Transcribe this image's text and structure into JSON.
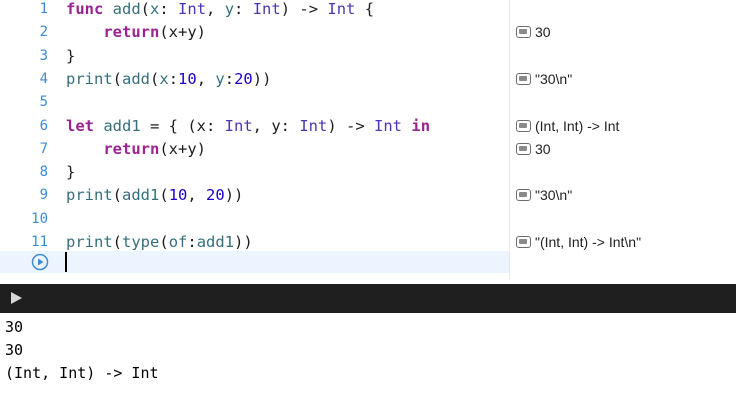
{
  "editor": {
    "lines": [
      {
        "num": "1",
        "tokens": [
          {
            "t": "keyword",
            "v": "func"
          },
          {
            "t": "plain",
            "v": " "
          },
          {
            "t": "func",
            "v": "add"
          },
          {
            "t": "plain",
            "v": "("
          },
          {
            "t": "func",
            "v": "x"
          },
          {
            "t": "plain",
            "v": ": "
          },
          {
            "t": "type",
            "v": "Int"
          },
          {
            "t": "plain",
            "v": ", "
          },
          {
            "t": "func",
            "v": "y"
          },
          {
            "t": "plain",
            "v": ": "
          },
          {
            "t": "type",
            "v": "Int"
          },
          {
            "t": "plain",
            "v": ") -> "
          },
          {
            "t": "type",
            "v": "Int"
          },
          {
            "t": "plain",
            "v": " {"
          }
        ]
      },
      {
        "num": "2",
        "tokens": [
          {
            "t": "plain",
            "v": "    "
          },
          {
            "t": "keyword",
            "v": "return"
          },
          {
            "t": "plain",
            "v": "(x+y)"
          }
        ]
      },
      {
        "num": "3",
        "tokens": [
          {
            "t": "plain",
            "v": "}"
          }
        ]
      },
      {
        "num": "4",
        "tokens": [
          {
            "t": "func",
            "v": "print"
          },
          {
            "t": "plain",
            "v": "("
          },
          {
            "t": "func",
            "v": "add"
          },
          {
            "t": "plain",
            "v": "("
          },
          {
            "t": "func",
            "v": "x"
          },
          {
            "t": "plain",
            "v": ":"
          },
          {
            "t": "num",
            "v": "10"
          },
          {
            "t": "plain",
            "v": ", "
          },
          {
            "t": "func",
            "v": "y"
          },
          {
            "t": "plain",
            "v": ":"
          },
          {
            "t": "num",
            "v": "20"
          },
          {
            "t": "plain",
            "v": "))"
          }
        ]
      },
      {
        "num": "5",
        "tokens": []
      },
      {
        "num": "6",
        "tokens": [
          {
            "t": "keyword",
            "v": "let"
          },
          {
            "t": "plain",
            "v": " "
          },
          {
            "t": "func",
            "v": "add1"
          },
          {
            "t": "plain",
            "v": " = { (x: "
          },
          {
            "t": "type",
            "v": "Int"
          },
          {
            "t": "plain",
            "v": ", y: "
          },
          {
            "t": "type",
            "v": "Int"
          },
          {
            "t": "plain",
            "v": ") -> "
          },
          {
            "t": "type",
            "v": "Int"
          },
          {
            "t": "plain",
            "v": " "
          },
          {
            "t": "keyword",
            "v": "in"
          }
        ]
      },
      {
        "num": "7",
        "tokens": [
          {
            "t": "plain",
            "v": "    "
          },
          {
            "t": "keyword",
            "v": "return"
          },
          {
            "t": "plain",
            "v": "(x+y)"
          }
        ]
      },
      {
        "num": "8",
        "tokens": [
          {
            "t": "plain",
            "v": "}"
          }
        ]
      },
      {
        "num": "9",
        "tokens": [
          {
            "t": "func",
            "v": "print"
          },
          {
            "t": "plain",
            "v": "("
          },
          {
            "t": "func",
            "v": "add1"
          },
          {
            "t": "plain",
            "v": "("
          },
          {
            "t": "num",
            "v": "10"
          },
          {
            "t": "plain",
            "v": ", "
          },
          {
            "t": "num",
            "v": "20"
          },
          {
            "t": "plain",
            "v": "))"
          }
        ]
      },
      {
        "num": "10",
        "tokens": []
      },
      {
        "num": "11",
        "tokens": [
          {
            "t": "func",
            "v": "print"
          },
          {
            "t": "plain",
            "v": "("
          },
          {
            "t": "func",
            "v": "type"
          },
          {
            "t": "plain",
            "v": "("
          },
          {
            "t": "func",
            "v": "of"
          },
          {
            "t": "plain",
            "v": ":"
          },
          {
            "t": "func",
            "v": "add1"
          },
          {
            "t": "plain",
            "v": "))"
          }
        ]
      }
    ],
    "results": [
      {
        "line": 2,
        "text": "30"
      },
      {
        "line": 4,
        "text": "\"30\\n\""
      },
      {
        "line": 6,
        "text": "(Int, Int) -> Int"
      },
      {
        "line": 7,
        "text": "30"
      },
      {
        "line": 9,
        "text": "\"30\\n\""
      },
      {
        "line": 11,
        "text": "\"(Int, Int) -> Int\\n\""
      }
    ]
  },
  "console": {
    "lines": [
      "30",
      "30",
      "(Int, Int) -> Int"
    ]
  },
  "icons": {
    "run": "run-play-icon",
    "console_toggle": "triangle-right-icon",
    "quicklook": "quicklook-icon"
  },
  "colors": {
    "keyword": "#9b2393",
    "type": "#4d35b3",
    "function": "#356f7c",
    "number": "#1c00cf",
    "line_number": "#3d8bd6",
    "current_line": "#ecf5ff",
    "console_bar": "#1f1f1f"
  }
}
